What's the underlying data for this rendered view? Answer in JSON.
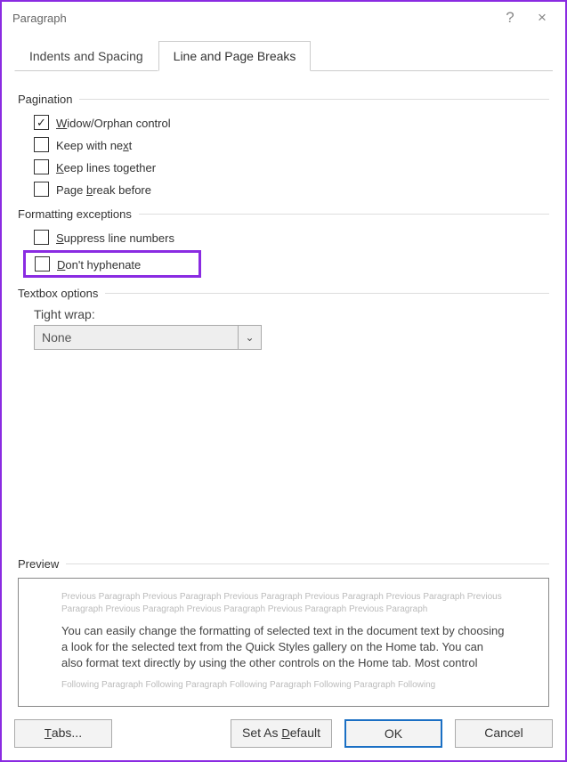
{
  "window": {
    "title": "Paragraph",
    "help_tooltip": "?",
    "close_tooltip": "×"
  },
  "tabs": {
    "indents": "Indents and Spacing",
    "linebreaks": "Line and Page Breaks"
  },
  "pagination": {
    "heading": "Pagination",
    "widow": {
      "label_pre": "",
      "u": "W",
      "label_post": "idow/Orphan control",
      "checked": true
    },
    "keepnext": {
      "label_pre": "Keep with ne",
      "u": "x",
      "label_post": "t",
      "checked": false
    },
    "keeplines": {
      "u": "K",
      "label_post": "eep lines together",
      "checked": false
    },
    "pagebreak": {
      "label_pre": "Page ",
      "u": "b",
      "label_post": "reak before",
      "checked": false
    }
  },
  "formatting": {
    "heading": "Formatting exceptions",
    "suppress": {
      "u": "S",
      "label_post": "uppress line numbers",
      "checked": false
    },
    "hyphen": {
      "u": "D",
      "label_post": "on't hyphenate",
      "checked": false
    }
  },
  "textbox": {
    "heading": "Textbox options",
    "tight_label": "Tight wrap:",
    "tight_value": "None"
  },
  "preview": {
    "heading": "Preview",
    "faded_prev": "Previous Paragraph Previous Paragraph Previous Paragraph Previous Paragraph Previous Paragraph Previous Paragraph Previous Paragraph Previous Paragraph Previous Paragraph Previous Paragraph",
    "body": "You can easily change the formatting of selected text in the document text by choosing a look for the selected text from the Quick Styles gallery on the Home tab. You can also format text directly by using the other controls on the Home tab. Most control",
    "faded_next": "Following Paragraph Following Paragraph Following Paragraph Following Paragraph Following"
  },
  "buttons": {
    "tabs": "Tabs...",
    "default": "Set As Default",
    "ok": "OK",
    "cancel": "Cancel"
  },
  "u_tabs": "T",
  "u_default": "D"
}
